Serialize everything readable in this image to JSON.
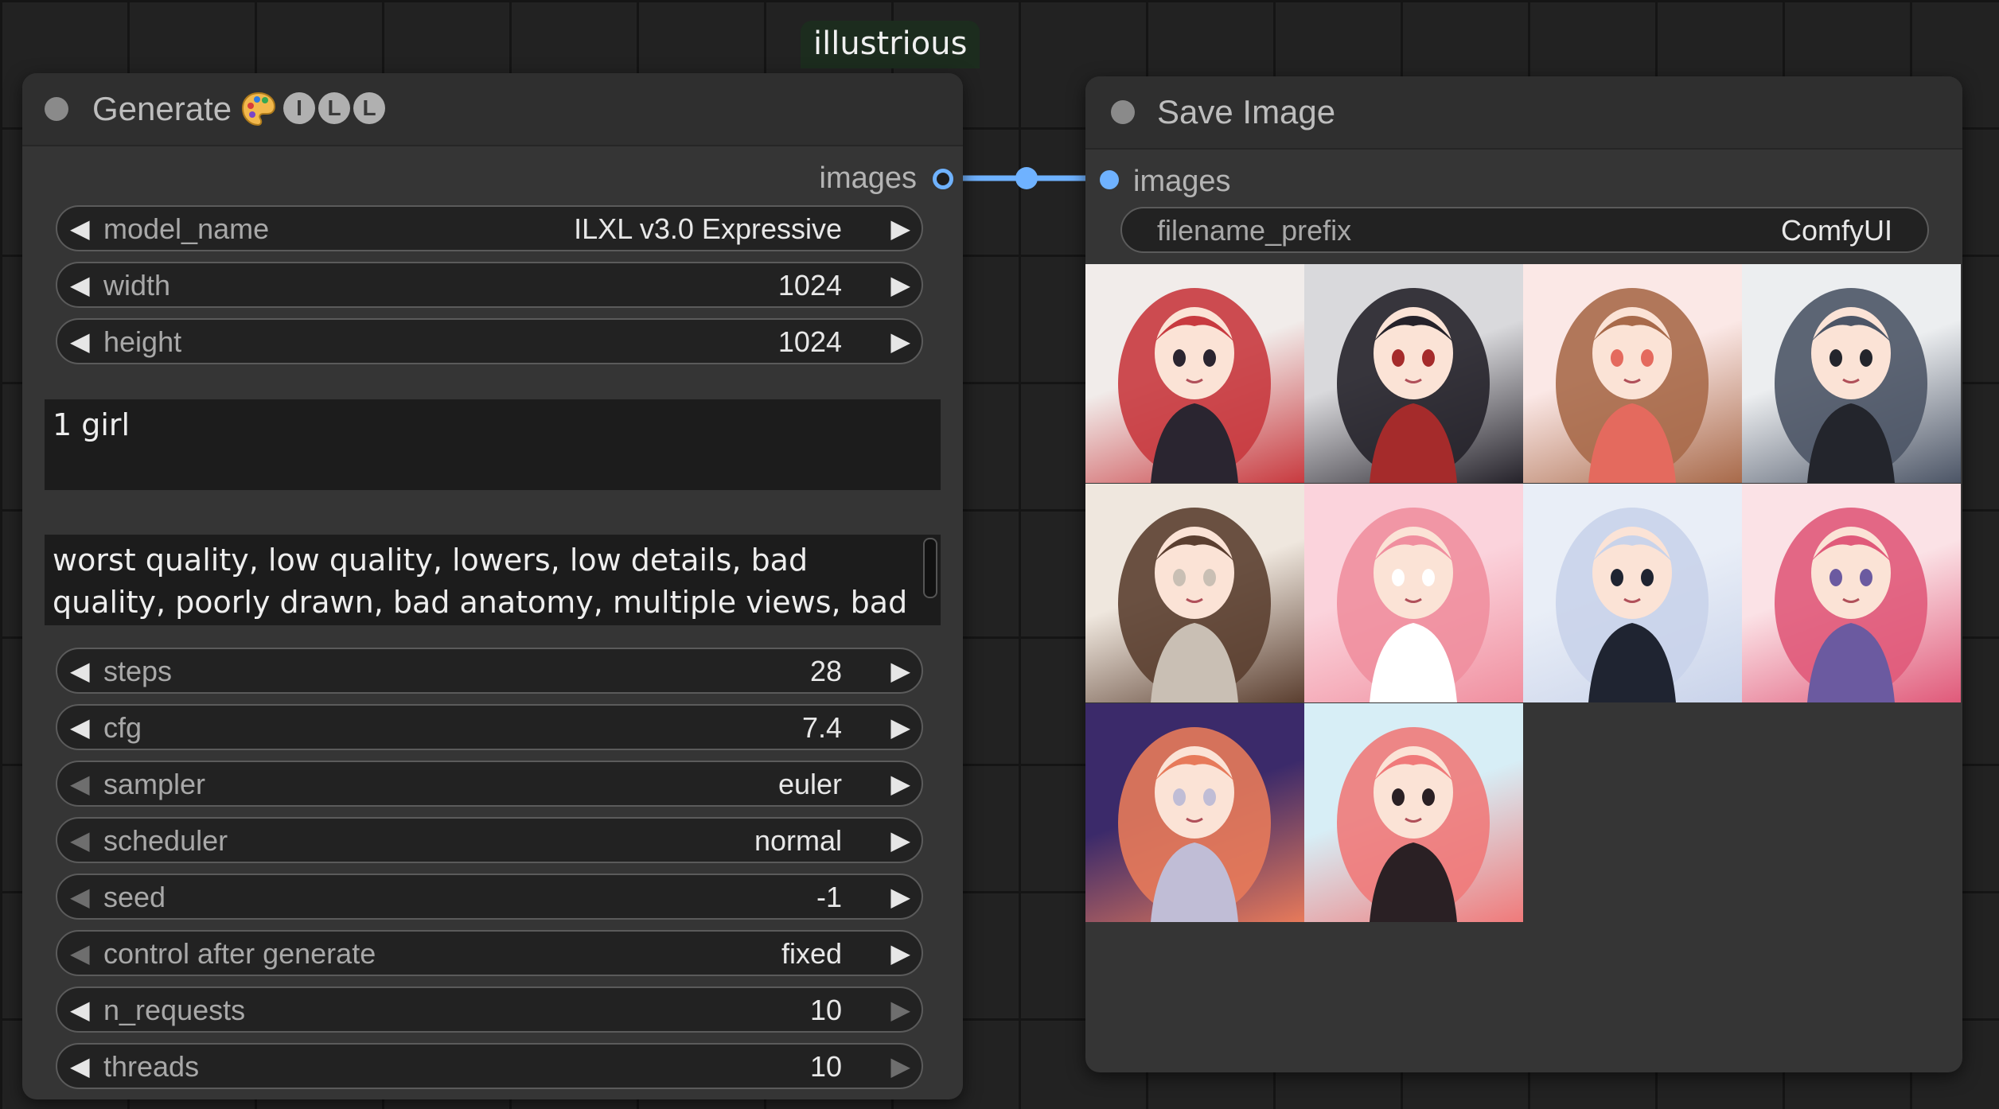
{
  "graph": {
    "group_badge": "illustrious"
  },
  "generate_node": {
    "title": "Generate",
    "badge_icon": "palette-icon",
    "badges": [
      "I",
      "L",
      "L"
    ],
    "output_slot": "images",
    "widgets_top": [
      {
        "label": "model_name",
        "value": "ILXL v3.0 Expressive",
        "left_enabled": true,
        "right_enabled": true
      },
      {
        "label": "width",
        "value": "1024",
        "left_enabled": true,
        "right_enabled": true
      },
      {
        "label": "height",
        "value": "1024",
        "left_enabled": true,
        "right_enabled": true
      }
    ],
    "positive_prompt": "1 girl",
    "negative_prompt": "worst quality, low quality, lowers, low details, bad quality, poorly drawn, bad anatomy, multiple views, bad hands, blurry, artist sign,",
    "widgets_bottom": [
      {
        "label": "steps",
        "value": "28",
        "left_enabled": true,
        "right_enabled": true
      },
      {
        "label": "cfg",
        "value": "7.4",
        "left_enabled": true,
        "right_enabled": true
      },
      {
        "label": "sampler",
        "value": "euler",
        "left_enabled": false,
        "right_enabled": true
      },
      {
        "label": "scheduler",
        "value": "normal",
        "left_enabled": false,
        "right_enabled": true
      },
      {
        "label": "seed",
        "value": "-1",
        "left_enabled": false,
        "right_enabled": true
      },
      {
        "label": "control after generate",
        "value": "fixed",
        "left_enabled": false,
        "right_enabled": true
      },
      {
        "label": "n_requests",
        "value": "10",
        "left_enabled": true,
        "right_enabled": false
      },
      {
        "label": "threads",
        "value": "10",
        "left_enabled": true,
        "right_enabled": false
      }
    ]
  },
  "save_node": {
    "title": "Save Image",
    "input_slot": "images",
    "filename_prefix": {
      "label": "filename_prefix",
      "value": "ComfyUI"
    },
    "images": [
      {
        "name": "red-hair-uniform-girl",
        "colors": [
          "#f1ecea",
          "#c83a3f",
          "#2a2530"
        ]
      },
      {
        "name": "black-hair-red-cape-girl",
        "colors": [
          "#d9d9dc",
          "#25222a",
          "#a52b2b"
        ]
      },
      {
        "name": "cat-ear-brown-hair-girl",
        "colors": [
          "#fbe8e6",
          "#a86a4a",
          "#e46a5e"
        ]
      },
      {
        "name": "grey-hair-black-dress-girl",
        "colors": [
          "#eceef0",
          "#4c5566",
          "#23252c"
        ]
      },
      {
        "name": "brown-hair-red-ribbon-girl",
        "colors": [
          "#efe7de",
          "#5b3f30",
          "#c9bfb4"
        ]
      },
      {
        "name": "pink-hair-maid-girl",
        "colors": [
          "#fbd3dc",
          "#f08f9f",
          "#ffffff"
        ]
      },
      {
        "name": "white-hair-microphone-girl",
        "colors": [
          "#e9eef7",
          "#c9d3ea",
          "#1f2431"
        ]
      },
      {
        "name": "pink-hair-cat-girl",
        "colors": [
          "#fbe2e6",
          "#e05a7a",
          "#6b5aa0"
        ]
      },
      {
        "name": "silver-hair-sunset-girl",
        "colors": [
          "#3b2a6a",
          "#e77a5a",
          "#c0bdd6"
        ]
      },
      {
        "name": "pink-hair-blue-eyes-girl",
        "colors": [
          "#d7eef6",
          "#f07a7a",
          "#2a2024"
        ]
      }
    ]
  },
  "colors": {
    "link": "#6fb2ff",
    "node_bg": "#353535",
    "canvas_bg": "#222222"
  }
}
